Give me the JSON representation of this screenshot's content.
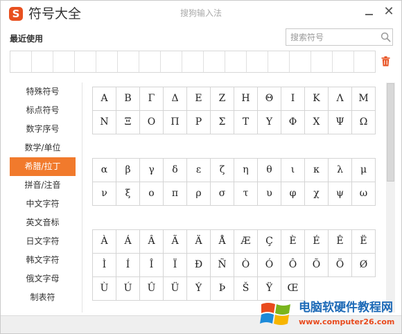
{
  "app": {
    "title": "符号大全",
    "logo_letter": "S",
    "window_title": "搜狗输入法",
    "close_glyph": "✕"
  },
  "recent": {
    "label": "最近使用",
    "slot_count": 17
  },
  "search": {
    "placeholder": "搜索符号",
    "value": ""
  },
  "sidebar": {
    "items": [
      {
        "label": "特殊符号",
        "active": false
      },
      {
        "label": "标点符号",
        "active": false
      },
      {
        "label": "数字序号",
        "active": false
      },
      {
        "label": "数学/单位",
        "active": false
      },
      {
        "label": "希腊/拉丁",
        "active": true
      },
      {
        "label": "拼音/注音",
        "active": false
      },
      {
        "label": "中文字符",
        "active": false
      },
      {
        "label": "英文音标",
        "active": false
      },
      {
        "label": "日文字符",
        "active": false
      },
      {
        "label": "韩文字符",
        "active": false
      },
      {
        "label": "俄文字母",
        "active": false
      },
      {
        "label": "制表符",
        "active": false
      }
    ]
  },
  "groups": [
    {
      "symbols": [
        "Α",
        "Β",
        "Γ",
        "Δ",
        "Ε",
        "Ζ",
        "Η",
        "Θ",
        "Ι",
        "Κ",
        "Λ",
        "Μ",
        "Ν",
        "Ξ",
        "Ο",
        "Π",
        "Ρ",
        "Σ",
        "Τ",
        "Υ",
        "Φ",
        "Χ",
        "Ψ",
        "Ω"
      ]
    },
    {
      "symbols": [
        "α",
        "β",
        "γ",
        "δ",
        "ε",
        "ζ",
        "η",
        "θ",
        "ι",
        "κ",
        "λ",
        "μ",
        "ν",
        "ξ",
        "ο",
        "π",
        "ρ",
        "σ",
        "τ",
        "υ",
        "φ",
        "χ",
        "ψ",
        "ω"
      ]
    },
    {
      "symbols": [
        "À",
        "Á",
        "Â",
        "Ã",
        "Ä",
        "Å",
        "Æ",
        "Ç",
        "È",
        "É",
        "Ê",
        "Ë",
        "Ì",
        "Í",
        "Î",
        "Ï",
        "Ð",
        "Ñ",
        "Ò",
        "Ó",
        "Ô",
        "Õ",
        "Ö",
        "Ø",
        "Ù",
        "Ú",
        "Û",
        "Ü",
        "Ý",
        "Þ",
        "Š",
        "Ÿ",
        "Œ"
      ]
    }
  ],
  "watermark": {
    "title": "电脑软硬件教程网",
    "url": "www.computer26.com"
  },
  "colors": {
    "accent": "#f17a2c",
    "logo": "#e8501f",
    "watermark_title": "#1d6ab7",
    "watermark_url": "#e84a1d"
  },
  "icons": {
    "logo": "sogou-logo",
    "search": "search-icon",
    "trash": "trash-icon",
    "minimize": "minimize-icon",
    "close": "close-icon"
  }
}
